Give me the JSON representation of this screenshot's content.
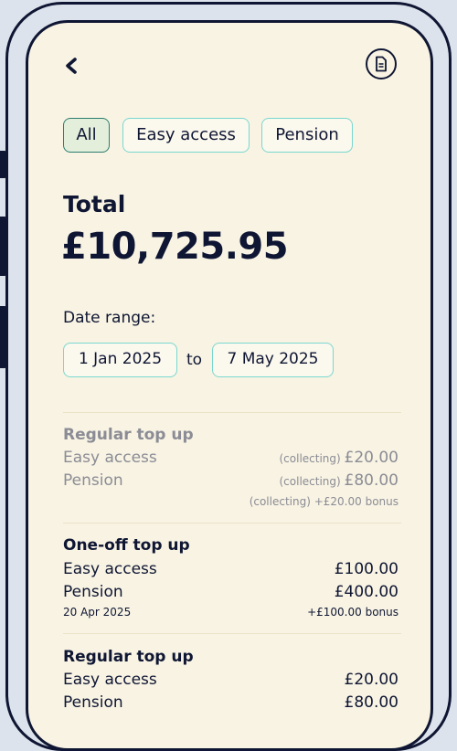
{
  "nav": {
    "back_icon": "chevron-left-icon",
    "statement_icon": "document-icon"
  },
  "filters": [
    {
      "label": "All",
      "active": true
    },
    {
      "label": "Easy access",
      "active": false
    },
    {
      "label": "Pension",
      "active": false
    }
  ],
  "total": {
    "label": "Total",
    "value": "£10,725.95"
  },
  "date_range": {
    "label": "Date range:",
    "from": "1 Jan 2025",
    "to_word": "to",
    "to": "7 May 2025"
  },
  "transactions": [
    {
      "title": "Regular top up",
      "status": "pending",
      "lines": [
        {
          "account": "Easy access",
          "prefix": "(collecting) ",
          "amount": "£20.00"
        },
        {
          "account": "Pension",
          "prefix": "(collecting) ",
          "amount": "£80.00"
        }
      ],
      "date": "",
      "bonus": "(collecting) +£20.00 bonus"
    },
    {
      "title": "One-off top up",
      "status": "complete",
      "lines": [
        {
          "account": "Easy access",
          "prefix": "",
          "amount": "£100.00"
        },
        {
          "account": "Pension",
          "prefix": "",
          "amount": "£400.00"
        }
      ],
      "date": "20 Apr 2025",
      "bonus": "+£100.00 bonus"
    },
    {
      "title": "Regular top up",
      "status": "complete",
      "lines": [
        {
          "account": "Easy access",
          "prefix": "",
          "amount": "£20.00"
        },
        {
          "account": "Pension",
          "prefix": "",
          "amount": "£80.00"
        }
      ],
      "date": "",
      "bonus": ""
    }
  ],
  "colors": {
    "navy": "#0f1633",
    "cream": "#f8f3e3",
    "teal_border": "#79d8cf",
    "active_chip": "#e3eedb",
    "muted": "#8b8c95"
  }
}
